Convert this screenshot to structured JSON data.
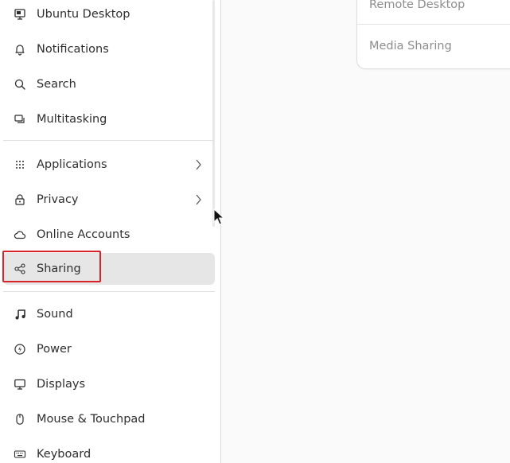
{
  "sidebar": {
    "items": [
      {
        "label": "Ubuntu Desktop",
        "icon": "ubuntu-desktop-icon"
      },
      {
        "label": "Notifications",
        "icon": "bell-icon"
      },
      {
        "label": "Search",
        "icon": "search-icon"
      },
      {
        "label": "Multitasking",
        "icon": "multitasking-icon"
      },
      {
        "label": "Applications",
        "icon": "grid-icon"
      },
      {
        "label": "Privacy",
        "icon": "lock-icon"
      },
      {
        "label": "Online Accounts",
        "icon": "cloud-icon"
      },
      {
        "label": "Sharing",
        "icon": "share-icon"
      },
      {
        "label": "Sound",
        "icon": "music-note-icon"
      },
      {
        "label": "Power",
        "icon": "power-icon"
      },
      {
        "label": "Displays",
        "icon": "monitor-icon"
      },
      {
        "label": "Mouse & Touchpad",
        "icon": "mouse-icon"
      },
      {
        "label": "Keyboard",
        "icon": "keyboard-icon"
      }
    ],
    "active_index": 7
  },
  "main": {
    "sharing_panel": {
      "rows": [
        {
          "label": "Remote Desktop"
        },
        {
          "label": "Media Sharing"
        }
      ]
    }
  },
  "colors": {
    "highlight": "#d9232a",
    "active_bg": "#e6e6e6"
  }
}
